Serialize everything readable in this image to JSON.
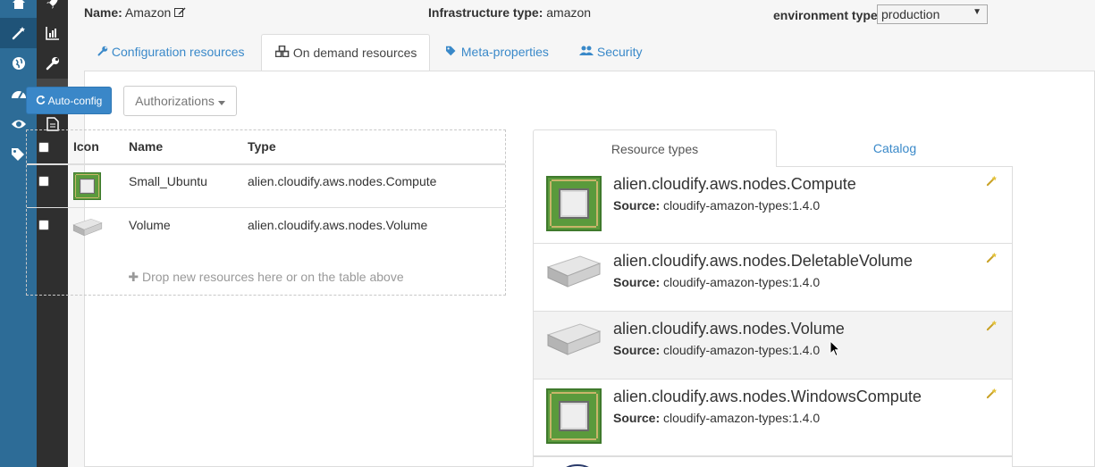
{
  "header": {
    "name_label": "Name:",
    "name_value": "Amazon",
    "infra_label": "Infrastructure type:",
    "infra_value": "amazon",
    "env_label": "environment type:",
    "env_value": "production"
  },
  "tabs": [
    {
      "label": "Configuration resources",
      "icon": "wrench-icon"
    },
    {
      "label": "On demand resources",
      "icon": "cubes-icon"
    },
    {
      "label": "Meta-properties",
      "icon": "tags-icon"
    },
    {
      "label": "Security",
      "icon": "users-icon"
    }
  ],
  "toolbar": {
    "auto_config_label": "Auto-config",
    "authorizations_label": "Authorizations"
  },
  "resources_table": {
    "headers": [
      "Icon",
      "Name",
      "Type"
    ],
    "rows": [
      {
        "name": "Small_Ubuntu",
        "type": "alien.cloudify.aws.nodes.Compute",
        "icon": "compute-chip-icon"
      },
      {
        "name": "Volume",
        "type": "alien.cloudify.aws.nodes.Volume",
        "icon": "volume-disk-icon"
      }
    ],
    "drop_hint": "Drop new resources here or on the table above"
  },
  "right_tabs": [
    "Resource types",
    "Catalog"
  ],
  "resource_types": [
    {
      "name": "alien.cloudify.aws.nodes.Compute",
      "source_label": "Source:",
      "source": "cloudify-amazon-types:1.4.0",
      "icon": "compute-chip-icon"
    },
    {
      "name": "alien.cloudify.aws.nodes.DeletableVolume",
      "source_label": "Source:",
      "source": "cloudify-amazon-types:1.4.0",
      "icon": "volume-disk-icon"
    },
    {
      "name": "alien.cloudify.aws.nodes.Volume",
      "source_label": "Source:",
      "source": "cloudify-amazon-types:1.4.0",
      "icon": "volume-disk-icon"
    },
    {
      "name": "alien.cloudify.aws.nodes.WindowsCompute",
      "source_label": "Source:",
      "source": "cloudify-amazon-types:1.4.0",
      "icon": "compute-chip-icon"
    }
  ],
  "colors": {
    "rail_primary": "#2d6c97",
    "rail_secondary": "#2f2f2f",
    "accent": "#3a87c8",
    "link": "#3a89c9"
  }
}
